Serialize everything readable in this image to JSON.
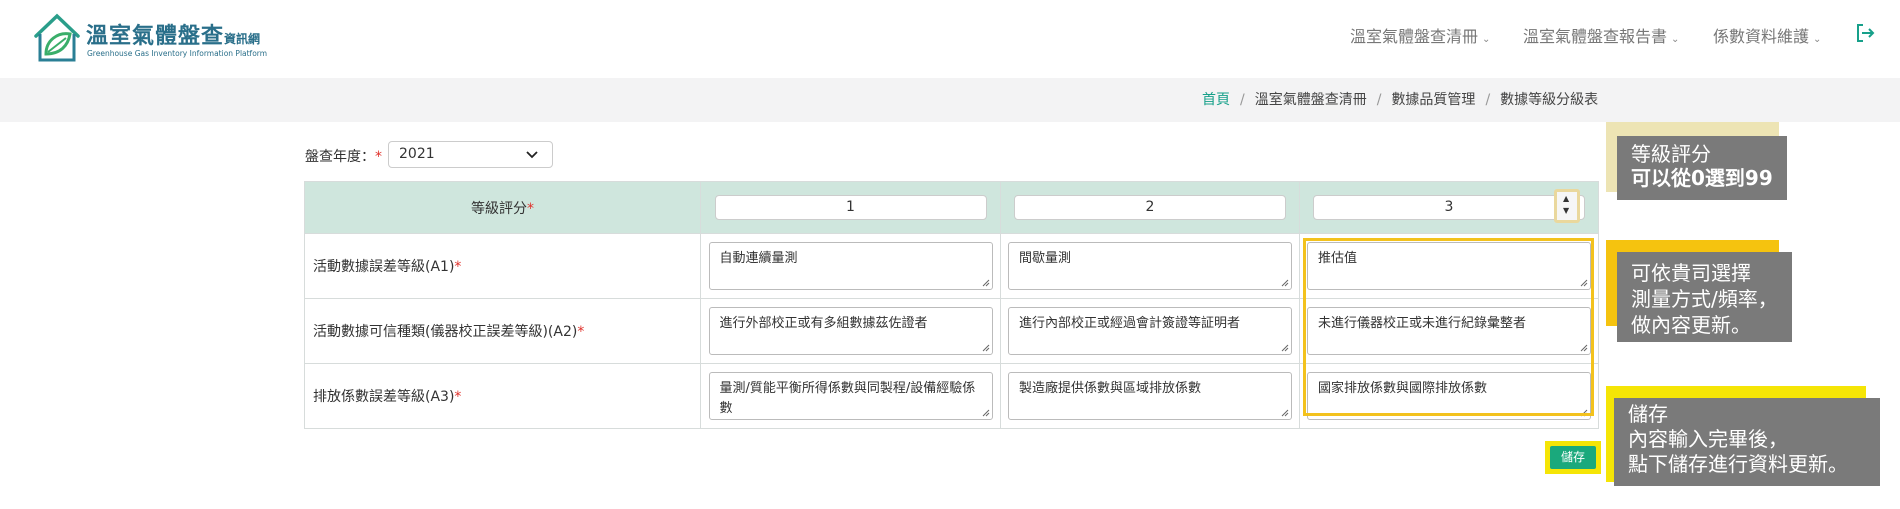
{
  "header": {
    "logo_title": "溫室氣體盤查",
    "logo_title_small": "資訊網",
    "logo_subtitle": "Greenhouse Gas Inventory Information Platform",
    "nav": [
      {
        "label": "溫室氣體盤查清冊"
      },
      {
        "label": "溫室氣體盤查報告書"
      },
      {
        "label": "係數資料維護"
      }
    ]
  },
  "breadcrumb": {
    "items": [
      "首頁",
      "溫室氣體盤查清冊",
      "數據品質管理",
      "數據等級分級表"
    ]
  },
  "form": {
    "year_label": "盤查年度：",
    "required_mark": "*",
    "year_value": "2021"
  },
  "table": {
    "header_label": "等級評分",
    "scores": [
      "1",
      "2",
      "3"
    ],
    "rows": [
      {
        "label": "活動數據誤差等級(A1)",
        "values": [
          "自動連續量測",
          "間歇量測",
          "推估值"
        ]
      },
      {
        "label": "活動數據可信種類(儀器校正誤差等級)(A2)",
        "values": [
          "進行外部校正或有多組數據茲佐證者",
          "進行內部校正或經過會計簽證等証明者",
          "未進行儀器校正或未進行紀錄彙整者"
        ]
      },
      {
        "label": "排放係數誤差等級(A3)",
        "values": [
          "量測/質能平衡所得係數與同製程/設備經驗係數",
          "製造廠提供係數與區域排放係數",
          "國家排放係數與國際排放係數"
        ]
      }
    ],
    "save_label": "儲存"
  },
  "notes": {
    "note1_line1": "等級評分",
    "note1_line2": "可以從0選到99",
    "note2_line1": "可依貴司選擇",
    "note2_line2": "測量方式/頻率，",
    "note2_line3": "做內容更新。",
    "note3_line1": "儲存",
    "note3_line2": "內容輸入完畢後，",
    "note3_line3": "點下儲存進行資料更新。"
  },
  "colors": {
    "brand": "#2a6f8a",
    "accent": "#17a08a",
    "highlight": "#f3c21d",
    "save_button": "#1aa97c"
  }
}
